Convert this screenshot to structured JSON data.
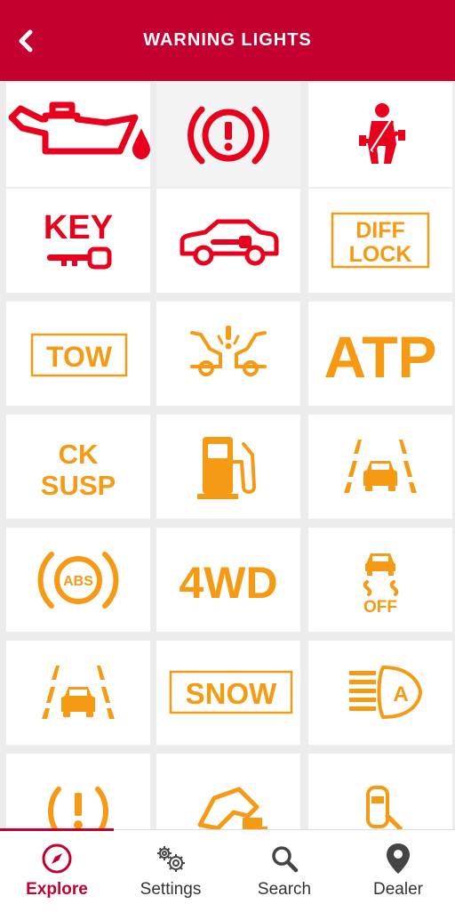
{
  "header": {
    "title": "WARNING LIGHTS",
    "back_icon": "chevron-left-icon"
  },
  "colors": {
    "brand": "#c3002f",
    "red": "#e8001c",
    "amber": "#f59a12"
  },
  "lights": {
    "key_label": "KEY",
    "diff_lock_line1": "DIFF",
    "diff_lock_line2": "LOCK",
    "tow_label": "TOW",
    "atp_label": "ATP",
    "ck_susp_line1": "CK",
    "ck_susp_line2": "SUSP",
    "abs_label": "ABS",
    "fourwd_label": "4WD",
    "vdc_off_label": "OFF",
    "snow_label": "SNOW",
    "auto_light_label": "A"
  },
  "tabs": [
    {
      "label": "Explore",
      "icon": "compass-icon",
      "active": true
    },
    {
      "label": "Settings",
      "icon": "gears-icon",
      "active": false
    },
    {
      "label": "Search",
      "icon": "search-icon",
      "active": false
    },
    {
      "label": "Dealer",
      "icon": "location-pin-icon",
      "active": false
    }
  ]
}
